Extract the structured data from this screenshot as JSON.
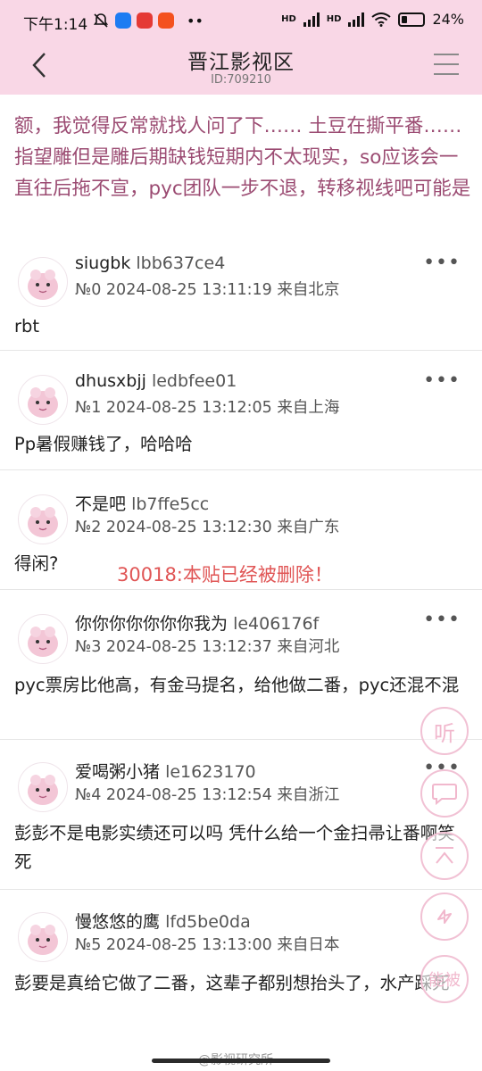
{
  "status_bar": {
    "time": "下午1:14",
    "signal_1": "HD",
    "signal_2": "HD",
    "battery": "24%"
  },
  "header": {
    "title": "晋江影视区",
    "id_text": "ID:709210"
  },
  "post": {
    "body": "额，我觉得反常就找人问了下…… 土豆在撕平番…… 指望雕但是雕后期缺钱短期内不太现实，so应该会一直往后拖不宣，pyc团队一步不退，转移视线吧可能是"
  },
  "replies": [
    {
      "username": "siugbk",
      "uid": "lbb637ce4",
      "floor": "№0",
      "datetime": "2024-08-25 13:11:19",
      "location": "来自北京",
      "content": "rbt"
    },
    {
      "username": "dhusxbjj",
      "uid": "ledbfee01",
      "floor": "№1",
      "datetime": "2024-08-25 13:12:05",
      "location": "来自上海",
      "content": "Pp暑假赚钱了，哈哈哈"
    },
    {
      "username": "不是吧",
      "uid": "lb7ffe5cc",
      "floor": "№2",
      "datetime": "2024-08-25 13:12:30",
      "location": "来自广东",
      "content": "得闲?"
    },
    {
      "username": "你你你你你你你我为",
      "uid": "le406176f",
      "floor": "№3",
      "datetime": "2024-08-25 13:12:37",
      "location": "来自河北",
      "content": "pyc票房比他高，有金马提名，给他做二番，pyc还混不混"
    },
    {
      "username": "爱喝粥小猪",
      "uid": "le1623170",
      "floor": "№4",
      "datetime": "2024-08-25 13:12:54",
      "location": "来自浙江",
      "content": "彭彭不是电影实绩还可以吗 凭什么给一个金扫帚让番啊笑死"
    },
    {
      "username": "慢悠悠的鹰",
      "uid": "lfd5be0da",
      "floor": "№5",
      "datetime": "2024-08-25 13:13:00",
      "location": "来自日本",
      "content": "彭要是真给它做了二番，这辈子都别想抬头了，水产踩死"
    }
  ],
  "deleted_notice": "30018:本贴已经被删除！",
  "more_label": "•••",
  "floating_buttons": {
    "listen": "听",
    "comment_icon": "chat-bubble-icon",
    "top_icon": "to-top-icon",
    "refresh_icon": "refresh-icon",
    "bottom_label": "能被"
  },
  "watermark": "@影视研究所",
  "colors": {
    "header_bg": "#f9d7e6",
    "post_text": "#9b4b72",
    "deleted": "#e05555",
    "float_border": "#f1c1d4"
  }
}
